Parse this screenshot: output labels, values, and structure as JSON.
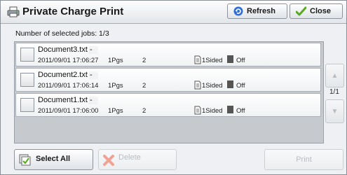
{
  "header": {
    "title": "Private Charge Print",
    "refresh_label": "Refresh",
    "close_label": "Close"
  },
  "selection": {
    "count_text": "Number of selected jobs: 1/3"
  },
  "jobs": [
    {
      "name": "Document3.txt -",
      "owner": "- ░░",
      "datetime": "2011/09/01 17:06:27",
      "pages": "1Pgs",
      "copies": "2",
      "sided": "1Sided",
      "staple": "Off"
    },
    {
      "name": "Document2.txt -",
      "owner": "- ░░",
      "datetime": "2011/09/01 17:06:14",
      "pages": "1Pgs",
      "copies": "2",
      "sided": "1Sided",
      "staple": "Off"
    },
    {
      "name": "Document1.txt -",
      "owner": "- ░░",
      "datetime": "2011/09/01 17:06:00",
      "pages": "1Pgs",
      "copies": "2",
      "sided": "1Sided",
      "staple": "Off"
    }
  ],
  "pagination": {
    "indicator": "1/1"
  },
  "footer": {
    "select_all_label": "Select All",
    "delete_label": "Delete",
    "print_label": "Print"
  },
  "icons": {
    "printer": "printer-icon",
    "refresh": "refresh-icon",
    "close": "checkmark-icon",
    "select_all": "select-all-icon",
    "delete": "x-icon",
    "sided": "document-icon",
    "staple": "staple-icon"
  },
  "colors": {
    "refresh_accent": "#2e6fd6",
    "close_accent": "#5aa820",
    "delete_accent": "#e04a2a"
  }
}
